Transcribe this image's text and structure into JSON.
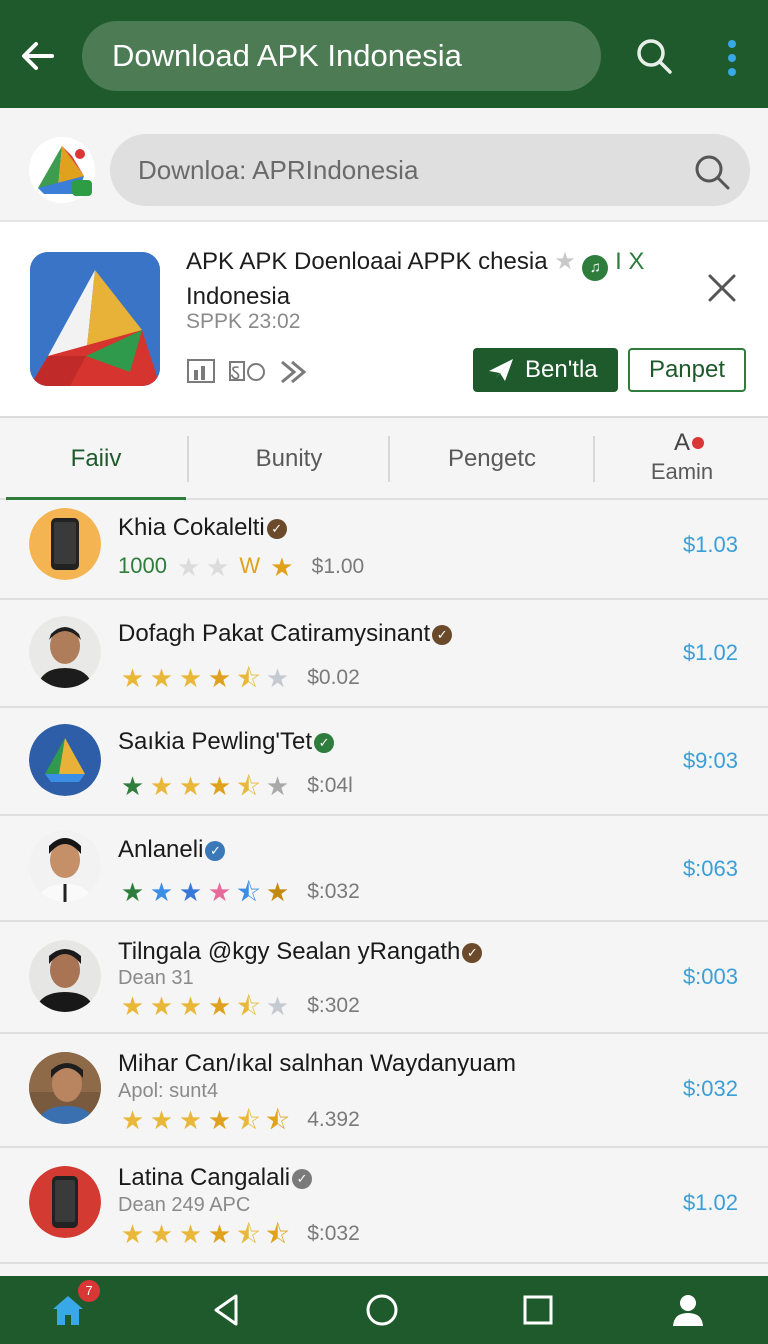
{
  "appbar": {
    "title": "Download APK Indonesia",
    "icons": [
      "back-arrow-icon",
      "search-icon",
      "more-vert-icon"
    ]
  },
  "search": {
    "placeholder": "Downloa: APRIndonesia",
    "icon": "search-icon"
  },
  "card": {
    "title_line1": "APK APK Doenloaai APPK chesia",
    "title_suffix": "I X",
    "title_line2": "Indonesia",
    "subtitle": "SPPK 23:02",
    "primary_button": "Ben'tla",
    "outline_button": "Panpet"
  },
  "tabs": [
    {
      "label": "Faiiv",
      "active": true
    },
    {
      "label": "Bunity",
      "active": false
    },
    {
      "label": "Pengetc",
      "active": false
    },
    {
      "glyph": "A",
      "label": "Eamin",
      "active": false
    }
  ],
  "list": [
    {
      "name": "Khia Cokalelti",
      "badge_color": "#6b4a2b",
      "count": "1000",
      "mark": "W",
      "rating_text": "$1.00",
      "price": "$1.03",
      "detail": ""
    },
    {
      "name": "Dofagh Pakat Catiramysinant",
      "badge_color": "#6b4a2b",
      "rating_text": "$0.02",
      "price": "$1.02",
      "detail": ""
    },
    {
      "name": "Saıkia Pewling'Tet",
      "badge_color": "#2e7d3c",
      "rating_text": "$:04l",
      "price": "$9:03",
      "detail": ""
    },
    {
      "name": "Anlaneli",
      "badge_color": "#3a78b8",
      "rating_text": "$:032",
      "price": "$:063",
      "detail": ""
    },
    {
      "name": "Tilngala @kgy Sealan yRangath",
      "badge_color": "#6b4a2b",
      "rating_text": "$:302",
      "price": "$:003",
      "detail": "Dean 31"
    },
    {
      "name": "Mihar Can/ıkal salnhan Waydanyuam",
      "badge_color": "",
      "rating_text": "4.392",
      "price": "$:032",
      "detail": "Apol: sunt4"
    },
    {
      "name": "Latina Cangalali",
      "badge_color": "#7a7a7a",
      "rating_text": "$:032",
      "price": "$1.02",
      "detail": "Dean 249 APC"
    }
  ],
  "navbar": {
    "home_badge": "7",
    "icons": [
      "home-icon",
      "back-triangle-icon",
      "home-circle-icon",
      "recents-square-icon",
      "profile-icon"
    ]
  }
}
